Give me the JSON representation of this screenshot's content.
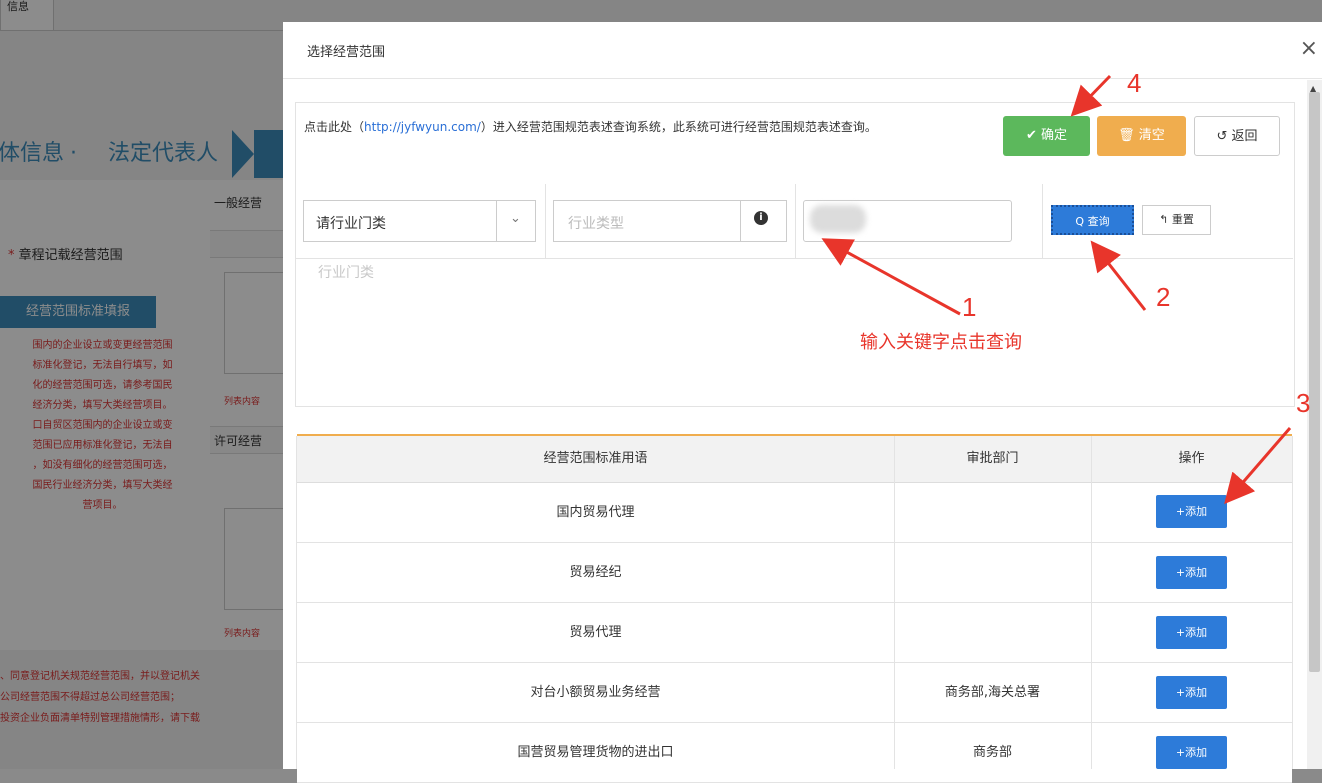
{
  "background": {
    "tab_label": "信息",
    "steps": {
      "step1": "体信息",
      "dot": "·",
      "step2": "法定代表人"
    },
    "required_label": "章程记载经营范围",
    "required_mark": "*",
    "fill_button": "经营范围标准填报",
    "red_note": [
      "围内的企业设立或变更经营范围",
      "标准化登记，无法自行填写，如",
      "化的经营范围可选，请参考国民",
      "经济分类，填写大类经营项目。",
      "口自贸区范围内的企业设立或变",
      "范围已应用标准化登记，无法自",
      "，如没有细化的经营范围可选，",
      "国民行业经济分类，填写大类经",
      "营项目。"
    ],
    "general_header": "一般经营",
    "permit_header": "许可经营",
    "list_note_1": "列表内容",
    "list_note_2": "列表内容",
    "bottom_red": [
      "、同意登记机关规范经营范围，并以登记机关",
      "公司经营范围不得超过总公司经营范围；",
      "投资企业负面清单特别管理措施情形，请下载"
    ]
  },
  "modal": {
    "title": "选择经营范围",
    "close": "×",
    "info_prefix": "点击此处（",
    "info_link": "http://jyfwyun.com/",
    "info_suffix": "）进入经营范围规范表述查询系统，此系统可进行经营范围规范表述查询。",
    "ok_label": "✔ 确定",
    "clear_label": "🗑 清空",
    "back_label": "↺ 返回",
    "industry_select": "请行业门类",
    "industry_type_placeholder": "行业类型",
    "query_label": "Q 查询",
    "reset_label": "↰ 重置",
    "hint": "行业门类"
  },
  "annotations": {
    "n1": "1",
    "n2": "2",
    "n3": "3",
    "n4": "4",
    "instruction": "输入关键字点击查询"
  },
  "table": {
    "headers": [
      "经营范围标准用语",
      "审批部门",
      "操作"
    ],
    "add_label": "+添加",
    "rows": [
      {
        "term": "国内贸易代理",
        "dept": ""
      },
      {
        "term": "贸易经纪",
        "dept": ""
      },
      {
        "term": "贸易代理",
        "dept": ""
      },
      {
        "term": "对台小额贸易业务经营",
        "dept": "商务部,海关总署"
      },
      {
        "term": "国营贸易管理货物的进出口",
        "dept": "商务部"
      }
    ]
  },
  "colors": {
    "primary": "#2d7bd9",
    "success": "#5cb85c",
    "warning": "#f0ad4e",
    "annotation": "#e8352b"
  }
}
